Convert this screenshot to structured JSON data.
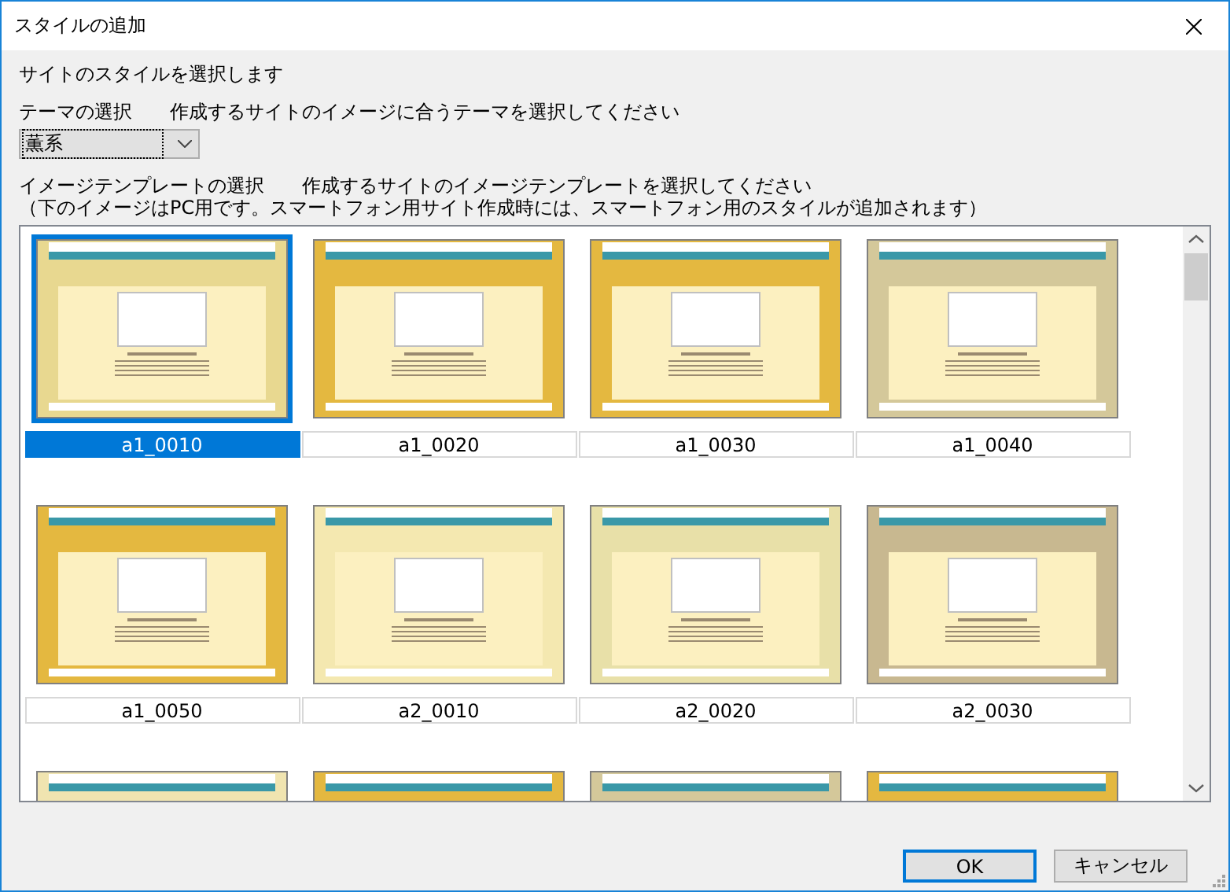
{
  "window": {
    "title": "スタイルの追加"
  },
  "intro": "サイトのスタイルを選択します",
  "theme": {
    "label": "テーマの選択",
    "hint": "作成するサイトのイメージに合うテーマを選択してください",
    "value": "薫系"
  },
  "template": {
    "label": "イメージテンプレートの選択",
    "hint": "作成するサイトのイメージテンプレートを選択してください",
    "note": "（下のイメージはPC用です。スマートフォン用サイト作成時には、スマートフォン用のスタイルが追加されます）"
  },
  "templates": [
    {
      "label": "a1_0010",
      "selected": true,
      "color": "#e8d890"
    },
    {
      "label": "a1_0020",
      "selected": false,
      "color": "#e4b840"
    },
    {
      "label": "a1_0030",
      "selected": false,
      "color": "#e4b840"
    },
    {
      "label": "a1_0040",
      "selected": false,
      "color": "#d4c89a"
    },
    {
      "label": "a1_0050",
      "selected": false,
      "color": "#e4b840"
    },
    {
      "label": "a2_0010",
      "selected": false,
      "color": "#f4e8b0"
    },
    {
      "label": "a2_0020",
      "selected": false,
      "color": "#e8e0a8"
    },
    {
      "label": "a2_0030",
      "selected": false,
      "color": "#c8b890"
    },
    {
      "selected": false,
      "color": "#f0e4b0"
    },
    {
      "selected": false,
      "color": "#e4b840"
    },
    {
      "selected": false,
      "color": "#d4c89a"
    },
    {
      "selected": false,
      "color": "#e4b840"
    }
  ],
  "buttons": [
    "OK",
    "キャンセル"
  ]
}
